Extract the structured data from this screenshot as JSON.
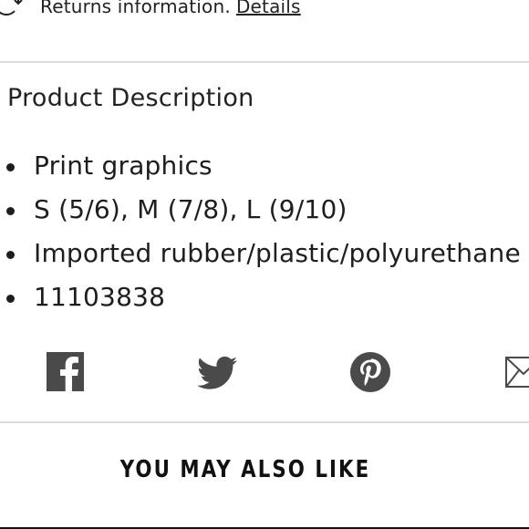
{
  "returns": {
    "text": "Returns information.",
    "link_label": "Details"
  },
  "product_description": {
    "title": "Product Description",
    "bullets": [
      "Print graphics",
      "S (5/6), M (7/8), L (9/10)",
      "Imported rubber/plastic/polyurethane",
      "11103838"
    ]
  },
  "social": {
    "icons": [
      "facebook-icon",
      "twitter-icon",
      "pinterest-icon",
      "email-icon"
    ],
    "icon_color": "#4a4a4a"
  },
  "recommendations": {
    "heading": "YOU MAY ALSO LIKE"
  }
}
